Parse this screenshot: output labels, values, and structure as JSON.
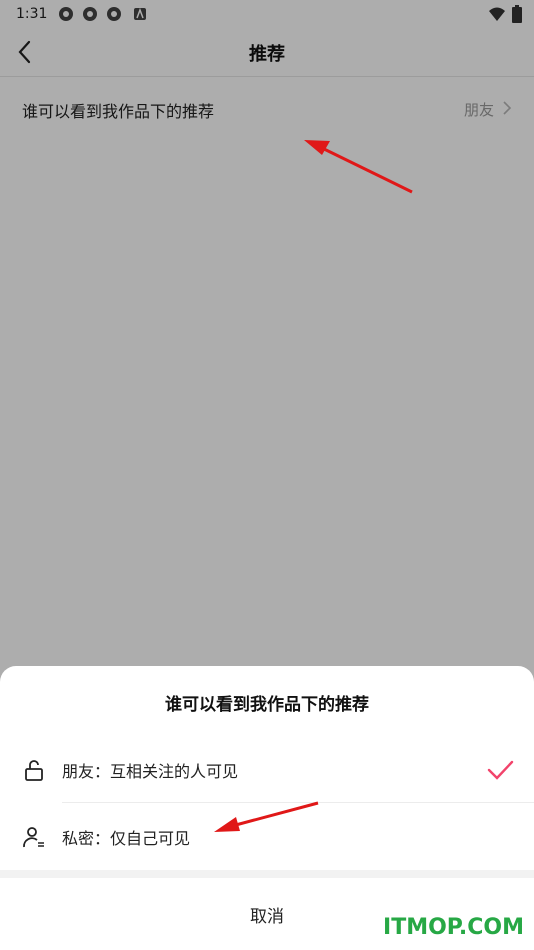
{
  "status_bar": {
    "time": "1:31"
  },
  "app_bar": {
    "title": "推荐"
  },
  "setting_row": {
    "label": "谁可以看到我作品下的推荐",
    "value": "朋友"
  },
  "sheet": {
    "title": "谁可以看到我作品下的推荐",
    "options": [
      {
        "label": "朋友：互相关注的人可见",
        "icon": "unlock-icon",
        "selected": true
      },
      {
        "label": "私密：仅自己可见",
        "icon": "user-private-icon",
        "selected": false
      }
    ],
    "cancel_label": "取消"
  },
  "watermark": "ITMOP.COM",
  "colors": {
    "accent": "#f2436b",
    "annotation_arrow": "#e01818",
    "watermark": "#27a845"
  }
}
